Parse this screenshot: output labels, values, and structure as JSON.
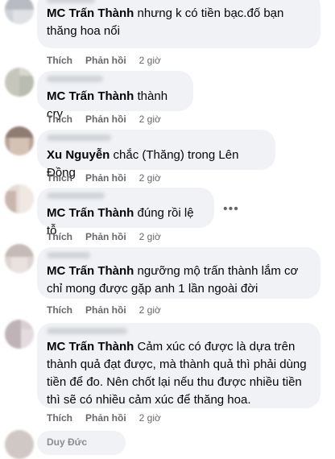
{
  "comments": [
    {
      "author": "",
      "tag": "MC Trấn Thành",
      "text": " nhưng k có tiền bạc.đố bạn thăng hoa nổi",
      "like_label": "Thích",
      "reply_label": "Phản hồi",
      "time": "2 giờ"
    },
    {
      "author": "",
      "tag": "MC Trấn Thành",
      "text": " thành cry",
      "like_label": "Thích",
      "reply_label": "Phản hồi",
      "time": "2 giờ"
    },
    {
      "author": "",
      "tag": "Xu Nguyễn",
      "text": " chắc (Thăng) trong Lên Đồng",
      "like_label": "Thích",
      "reply_label": "Phản hồi",
      "time": "2 giờ"
    },
    {
      "author": "",
      "tag": "MC Trấn Thành",
      "text": " đúng rồi lệ tỗ",
      "like_label": "Thích",
      "reply_label": "Phản hồi",
      "time": "2 giờ"
    },
    {
      "author": "",
      "tag": "MC Trấn Thành",
      "text": " ngưỡng mộ trấn thành lắm cơ chỉ mong được gặp anh 1 lần ngoài đời",
      "like_label": "Thích",
      "reply_label": "Phản hồi",
      "time": "2 giờ"
    },
    {
      "author": "",
      "tag": "MC Trấn Thành",
      "text": " Cảm xúc có được là dựa trên thành quả đạt được, mà thành quả thì phải dùng tiền để đo. Nên chốt lại nếu thu được nhiều tiền thì sẽ có nhiều cảm xúc để thăng hoa.",
      "like_label": "Thích",
      "reply_label": "Phản hồi",
      "time": "2 giờ"
    }
  ],
  "partial_next_author": "Duy Đức",
  "more_icon": "more-horizontal-icon"
}
